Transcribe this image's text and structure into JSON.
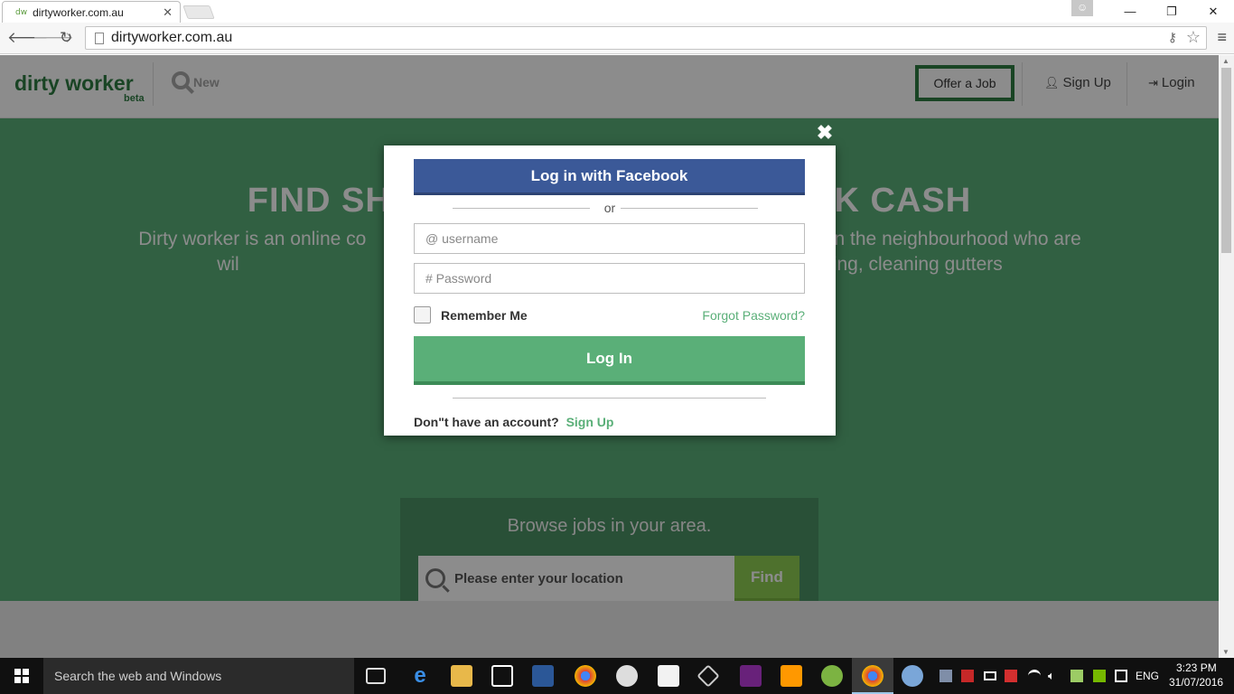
{
  "browser": {
    "tab_title": "dirtyworker.com.au",
    "tab_favicon": "dw",
    "url": "dirtyworker.com.au"
  },
  "header": {
    "logo": "dirty worker",
    "logo_sub": "beta",
    "search_label": "New",
    "offer_job": "Offer a Job",
    "sign_up": "Sign Up",
    "login": "Login"
  },
  "hero": {
    "title": "FIND SH                                        CK CASH",
    "description": "Dirty worker is an online co                                                      the house with those in the neighbourhood who are wil                                                      garden maintenance, basic landscaping, cleaning gutters                                                      g and a variety of other dirty"
  },
  "browse": {
    "title": "Browse jobs in your area.",
    "location_placeholder": "Please enter your location",
    "find_label": "Find"
  },
  "modal": {
    "facebook_label": "Log in with Facebook",
    "or_text": "or",
    "username_placeholder": "@ username",
    "password_placeholder": "# Password",
    "remember_label": "Remember Me",
    "forgot_label": "Forgot Password?",
    "login_label": "Log In",
    "no_account_text": "Don\"t have an account?",
    "signup_link": "Sign Up"
  },
  "taskbar": {
    "search_placeholder": "Search the web and Windows",
    "language": "ENG",
    "time": "3:23 PM",
    "date": "31/07/2016"
  },
  "colors": {
    "brand_green": "#5aaf78",
    "facebook_blue": "#3b5998",
    "find_green": "#8fce52"
  }
}
